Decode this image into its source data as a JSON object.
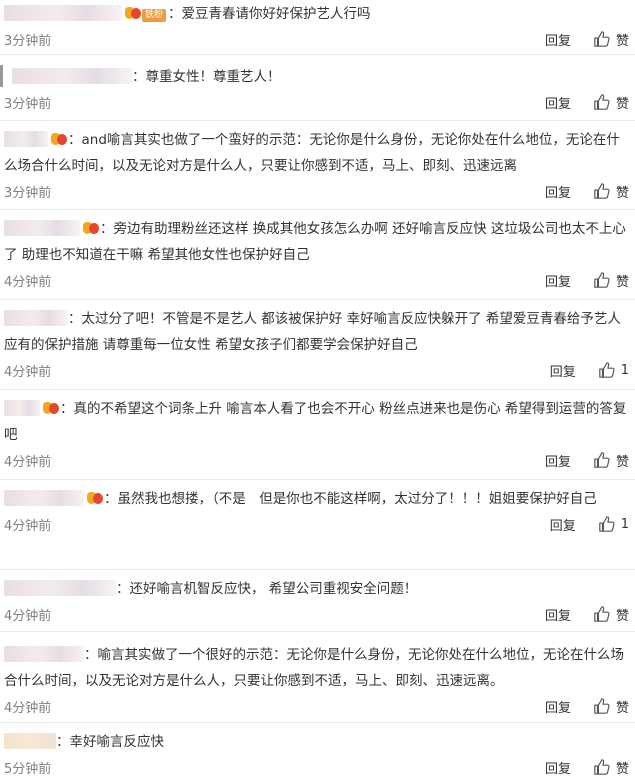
{
  "reply_label": "回复",
  "like_label": "赞",
  "comments": [
    {
      "time": "3分钟前",
      "text": "爱豆青春请你好好保护艺人行吗",
      "fan_tag": "铁粉",
      "likes": "赞"
    },
    {
      "time": "3分钟前",
      "text": "尊重女性！尊重艺人！",
      "likes": "赞"
    },
    {
      "time": "3分钟前",
      "text": "and喻言其实也做了一个蛮好的示范：无论你是什么身份，无论你处在什么地位，无论在什么场合什么时间，以及无论对方是什么人，只要让你感到不适，马上、即刻、迅速远离",
      "likes": "赞"
    },
    {
      "time": "4分钟前",
      "text": "旁边有助理粉丝还这样 换成其他女孩怎么办啊 还好喻言反应快 这垃圾公司也太不上心了 助理也不知道在干嘛 希望其他女性也保护好自己",
      "likes": "赞"
    },
    {
      "time": "4分钟前",
      "text": "太过分了吧！不管是不是艺人 都该被保护好 幸好喻言反应快躲开了 希望爱豆青春给予艺人应有的保护措施 请尊重每一位女性 希望女孩子们都要学会保护好自己",
      "likes": "1"
    },
    {
      "time": "4分钟前",
      "text": "真的不希望这个词条上升 喻言本人看了也会不开心 粉丝点进来也是伤心 希望得到运营的答复吧",
      "likes": "赞"
    },
    {
      "time": "4分钟前",
      "text": "虽然我也想搂，（不是　但是你也不能这样啊，太过分了！！！姐姐要保护好自己",
      "likes": "1"
    },
    {
      "time": "4分钟前",
      "text": "还好喻言机智反应快， 希望公司重视安全问题！",
      "likes": "赞"
    },
    {
      "time": "4分钟前",
      "text": "喻言其实做了一个很好的示范：无论你是什么身份，无论你处在什么地位，无论在什么场合什么时间，以及无论对方是什么人，只要让你感到不适，马上、即刻、迅速远离。",
      "likes": "赞"
    },
    {
      "time": "5分钟前",
      "text": "幸好喻言反应快",
      "likes": "赞"
    }
  ]
}
